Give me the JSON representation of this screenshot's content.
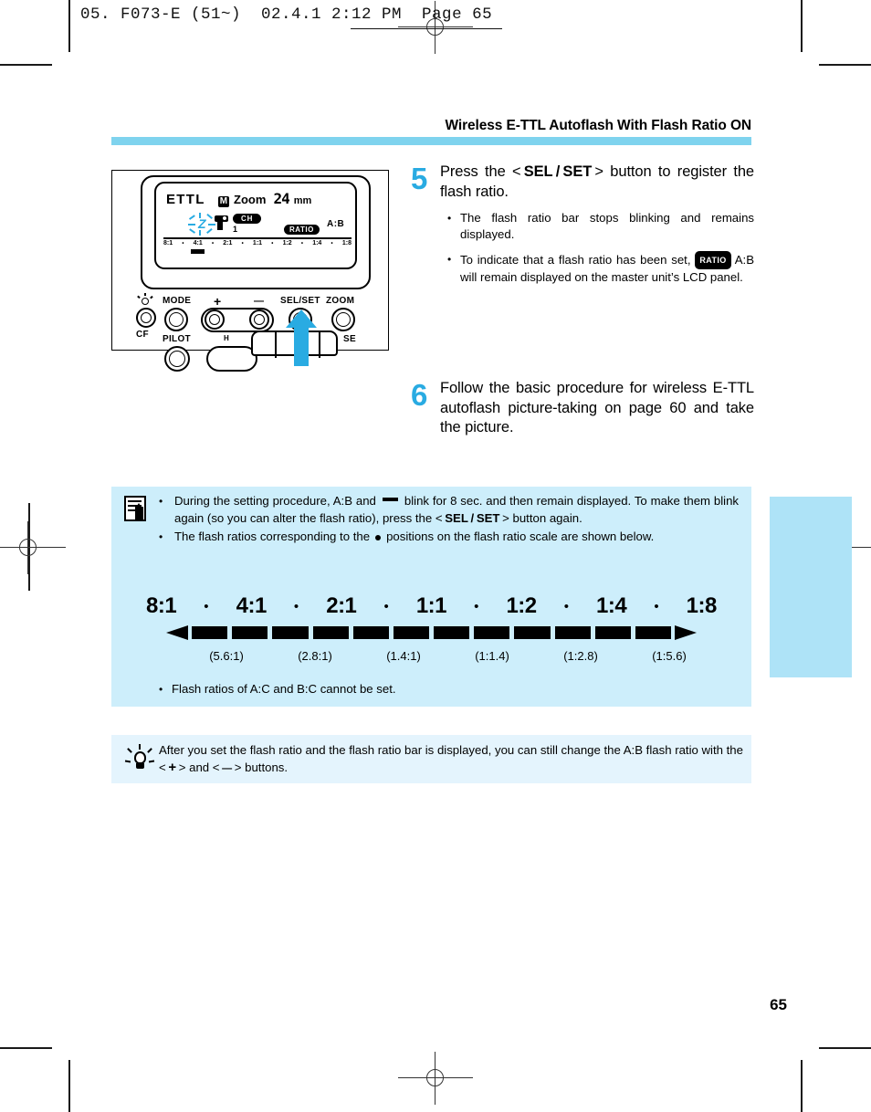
{
  "print_header": {
    "text": "05. F073-E (51~)  02.4.1 2:12 PM  Page 65"
  },
  "section": {
    "title": "Wireless E-TTL Autoflash With Flash Ratio ON"
  },
  "illustration": {
    "lcd": {
      "mode": "ETTL",
      "m_badge": "M",
      "zoom_label": "Zoom",
      "zoom_value": "24",
      "zoom_unit": "mm",
      "channel_badge": "CH",
      "channel_number": "1",
      "ratio_badge": "RATIO",
      "ab_label": "A:B",
      "scale": [
        "8:1",
        "4:1",
        "2:1",
        "1:1",
        "1:2",
        "1:4",
        "1:8"
      ],
      "scale_separator": "•",
      "blink_glyph": "Z"
    },
    "buttons": {
      "cf": "CF",
      "mode": "MODE",
      "plus": "+",
      "minus": "—",
      "sel_set": "SEL/SET",
      "zoom": "ZOOM",
      "pilot": "PILOT",
      "se": "SE",
      "high_speed_strip": "H"
    }
  },
  "steps": [
    {
      "number": "5",
      "title_parts": {
        "pre": "Press the < ",
        "kbd": "SEL / SET",
        "post": " > button to register the flash ratio."
      },
      "bullets": [
        {
          "pre": "The flash ratio bar stops blinking and remains displayed.",
          "tag": "",
          "post": ""
        },
        {
          "pre": "To indicate that a flash ratio has been set,",
          "tag": "RATIO",
          "post": "A:B will remain displayed on the master unit’s LCD panel."
        }
      ]
    },
    {
      "number": "6",
      "text": "Follow the basic procedure for wireless E-TTL autoflash picture-taking on page 60 and take the picture."
    }
  ],
  "note": {
    "icon": "memo-icon",
    "bullets": [
      {
        "pre": "During the setting procedure, A:B and",
        "mid": "blink for 8 sec. and then remain displayed. To make them blink again (so you can alter the flash ratio), press the < ",
        "kbd": "SEL / SET",
        "post": " > button again."
      },
      {
        "pre": "The flash ratios corresponding to the",
        "mid": "positions on the flash ratio scale are shown below.",
        "kbd": "",
        "post": ""
      }
    ],
    "footer_bullet": "Flash ratios of A:C and B:C cannot be set."
  },
  "ratio_scale": {
    "ratios": [
      "8:1",
      "4:1",
      "2:1",
      "1:1",
      "1:2",
      "1:4",
      "1:8"
    ],
    "separator": "•",
    "segment_count": 12,
    "sub_labels": [
      "(5.6:1)",
      "(2.8:1)",
      "(1.4:1)",
      "(1:1.4)",
      "(1:2.8)",
      "(1:5.6)"
    ]
  },
  "tip": {
    "icon": "lightbulb-icon",
    "line1": "After you set the flash ratio and the flash ratio bar is displayed, you can still change the",
    "line2_pre": "A:B flash ratio with the < ",
    "line2_plus": "+",
    "line2_mid": " > and < ",
    "line2_minus": "—",
    "line2_post": " > buttons."
  },
  "page_number": "65",
  "colors": {
    "accent_cyan": "#29ABE2",
    "rule_blue": "#7fd3ee",
    "note_bg": "#cdeefb",
    "tip_bg": "#e4f4fd",
    "sidetab": "#aee3f7"
  }
}
